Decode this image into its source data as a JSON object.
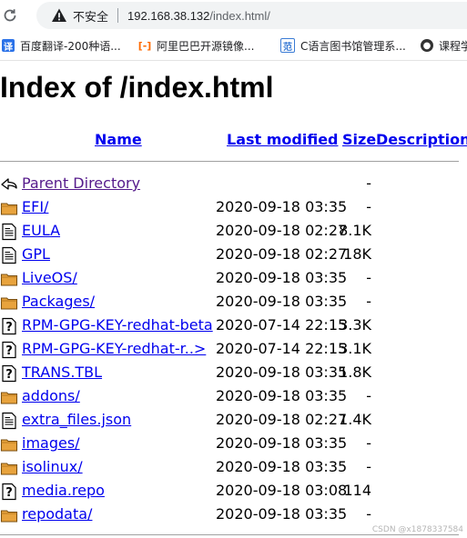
{
  "browser": {
    "insecure_label": "不安全",
    "url_host": "192.168.38.132",
    "url_path": "/index.html/"
  },
  "bookmarks": [
    {
      "label": "百度翻译-200种语...",
      "icon": "baidu-translate-icon",
      "color": "#2b72e8"
    },
    {
      "label": "阿里巴巴开源镜像...",
      "icon": "alibaba-icon",
      "color": "#ff6a00"
    },
    {
      "label": "C语言图书馆管理系...",
      "icon": "csdn-icon",
      "color": "#3a7bd5"
    },
    {
      "label": "课程学",
      "icon": "course-icon",
      "color": "#333333"
    }
  ],
  "page": {
    "title": "Index of /index.html",
    "columns": {
      "name": "Name",
      "modified": "Last modified",
      "size": "Size",
      "description": "Description"
    },
    "parent": {
      "name": "Parent Directory",
      "size": "-"
    },
    "entries": [
      {
        "name": "EFI/",
        "date": "2020-09-18 03:35",
        "size": "-",
        "type": "folder"
      },
      {
        "name": "EULA",
        "date": "2020-09-18 02:27",
        "size": "8.1K",
        "type": "text"
      },
      {
        "name": "GPL",
        "date": "2020-09-18 02:27",
        "size": "18K",
        "type": "text"
      },
      {
        "name": "LiveOS/",
        "date": "2020-09-18 03:35",
        "size": "-",
        "type": "folder"
      },
      {
        "name": "Packages/",
        "date": "2020-09-18 03:35",
        "size": "-",
        "type": "folder"
      },
      {
        "name": "RPM-GPG-KEY-redhat-beta",
        "date": "2020-07-14 22:15",
        "size": "3.3K",
        "type": "unknown"
      },
      {
        "name": "RPM-GPG-KEY-redhat-r..>",
        "date": "2020-07-14 22:15",
        "size": "3.1K",
        "type": "unknown"
      },
      {
        "name": "TRANS.TBL",
        "date": "2020-09-18 03:35",
        "size": "1.8K",
        "type": "unknown"
      },
      {
        "name": "addons/",
        "date": "2020-09-18 03:35",
        "size": "-",
        "type": "folder"
      },
      {
        "name": "extra_files.json",
        "date": "2020-09-18 02:27",
        "size": "1.4K",
        "type": "text"
      },
      {
        "name": "images/",
        "date": "2020-09-18 03:35",
        "size": "-",
        "type": "folder"
      },
      {
        "name": "isolinux/",
        "date": "2020-09-18 03:35",
        "size": "-",
        "type": "folder"
      },
      {
        "name": "media.repo",
        "date": "2020-09-18 03:08",
        "size": "114",
        "type": "unknown"
      },
      {
        "name": "repodata/",
        "date": "2020-09-18 03:35",
        "size": "-",
        "type": "folder"
      }
    ]
  },
  "watermark": "CSDN @x1878337584"
}
